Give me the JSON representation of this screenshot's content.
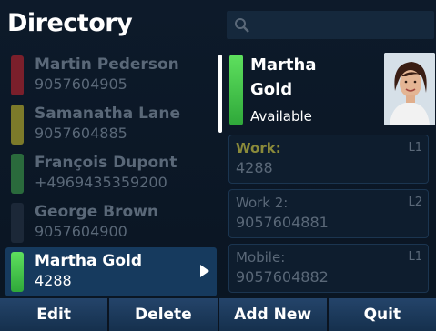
{
  "header": {
    "title": "Directory"
  },
  "contacts": [
    {
      "name": "Martin Pederson",
      "number": "9057604905",
      "color": "#7a1f2b"
    },
    {
      "name": "Samanatha Lane",
      "number": "9057604885",
      "color": "#7c7a2a"
    },
    {
      "name": "François Dupont",
      "number": "+4969435359200",
      "color": "#2a6a3c"
    },
    {
      "name": "George Brown",
      "number": "9057604900",
      "color": "#1c2838"
    },
    {
      "name": "Martha Gold",
      "number": "4288",
      "color": "#4fd64f"
    }
  ],
  "detail": {
    "first_name": "Martha",
    "last_name": "Gold",
    "status": "Available",
    "status_color": "#4fd64f",
    "phones": [
      {
        "label": "Work:",
        "value": "4288",
        "line": "L1"
      },
      {
        "label": "Work 2:",
        "value": "9057604881",
        "line": "L2"
      },
      {
        "label": "Mobile:",
        "value": "9057604882",
        "line": "L1"
      }
    ]
  },
  "softkeys": [
    "Edit",
    "Delete",
    "Add New",
    "Quit"
  ]
}
